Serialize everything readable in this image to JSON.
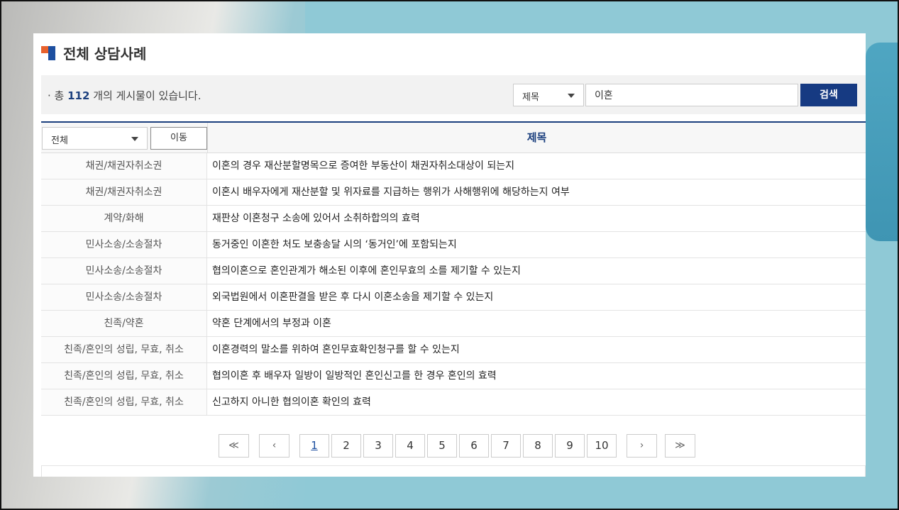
{
  "page_title": "전체 상담사례",
  "summary": {
    "prefix": "· 총 ",
    "count": "112",
    "suffix": " 개의 게시물이 있습니다."
  },
  "search": {
    "field_selected": "제목",
    "query": "이혼",
    "button_label": "검색"
  },
  "table": {
    "category_filter": "전체",
    "move_label": "이동",
    "title_header": "제목",
    "rows": [
      {
        "category": "채권/채권자취소권",
        "title": "이혼의 경우 재산분할명목으로 증여한 부동산이 채권자취소대상이 되는지"
      },
      {
        "category": "채권/채권자취소권",
        "title": "이혼시 배우자에게 재산분할 및 위자료를 지급하는 행위가 사해행위에 해당하는지 여부"
      },
      {
        "category": "계약/화해",
        "title": "재판상 이혼청구 소송에 있어서 소취하합의의 효력"
      },
      {
        "category": "민사소송/소송절차",
        "title": "동거중인 이혼한 처도 보충송달 시의 ‘동거인’에 포함되는지"
      },
      {
        "category": "민사소송/소송절차",
        "title": "협의이혼으로 혼인관계가 해소된 이후에 혼인무효의 소를 제기할 수 있는지"
      },
      {
        "category": "민사소송/소송절차",
        "title": "외국법원에서 이혼판결을 받은 후 다시 이혼소송을 제기할 수 있는지"
      },
      {
        "category": "친족/약혼",
        "title": "약혼 단계에서의 부정과 이혼"
      },
      {
        "category": "친족/혼인의 성립, 무효, 취소",
        "title": "이혼경력의 말소를 위하여 혼인무효확인청구를 할 수 있는지"
      },
      {
        "category": "친족/혼인의 성립, 무효, 취소",
        "title": "협의이혼 후 배우자 일방이 일방적인 혼인신고를 한 경우 혼인의 효력"
      },
      {
        "category": "친족/혼인의 성립, 무효, 취소",
        "title": "신고하지 아니한 협의이혼 확인의 효력"
      }
    ]
  },
  "pagination": {
    "first": "≪",
    "prev": "‹",
    "pages": [
      "1",
      "2",
      "3",
      "4",
      "5",
      "6",
      "7",
      "8",
      "9",
      "10"
    ],
    "current": "1",
    "next": "›",
    "last": "≫"
  }
}
